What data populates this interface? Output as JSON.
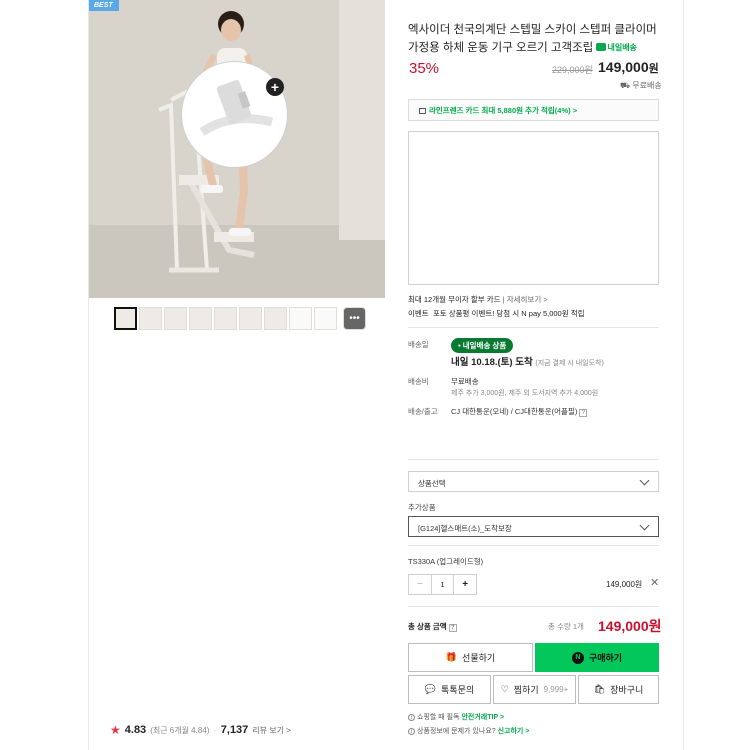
{
  "product": {
    "badge": "BEST",
    "title": "엑사이더 천국의계단 스텝밀 스카이 스텝퍼 클라이머 가정용 하체 운동 기구 오르기 고객조립",
    "delivery_tag": "내일배송",
    "discount": "35%",
    "original_price": "229,000원",
    "price": "149,000",
    "price_unit": "원",
    "shipping": "무료배송"
  },
  "card_banner": "라인프렌즈 카드 최대 5,880원 추가 적립(4%) >",
  "benefits": {
    "installment": "최대 12개월 무이자 할부 카드",
    "details_link": "자세히보기 >",
    "event_label": "이벤트",
    "event_text": "포토 상품평 이벤트! 당첨 시 N pay 5,000원 적립"
  },
  "delivery": {
    "label": "배송일",
    "pill": "내일배송 상품",
    "arrival": "내일 10.18.(토) 도착",
    "arrival_note": "(지금 결제 시 내일도착)",
    "fee_label": "배송비",
    "fee": "무료배송",
    "fee_note": "제주 추가 3,000원, 제주 외 도서지역 추가 4,000원",
    "courier_label": "배송/출고",
    "courier": "CJ 대한통운(오네) / CJ대한통운(어플필)"
  },
  "options": {
    "select_placeholder": "상품선택",
    "addon_label": "추가상품",
    "addon_value": "[G124]헬스매트(소)_도착보장",
    "selected_name": "TS330A (업그레이드형)",
    "qty": "1",
    "minus": "−",
    "plus": "+",
    "line_price": "149,000원",
    "remove": "✕"
  },
  "total": {
    "label": "총 상품 금액",
    "qty": "총 수량 1개",
    "price": "149,000원"
  },
  "buttons": {
    "gift": "선물하기",
    "buy": "구매하기",
    "talk": "톡톡문의",
    "wish": "찜하기",
    "wish_count": "9,999+",
    "cart": "장바구니"
  },
  "footer": {
    "line1_prefix": "쇼핑할 때 필독",
    "line1_link": "안전거래TIP >",
    "line2_prefix": "상품정보에 문제가 있나요?",
    "line2_link": "신고하기 >"
  },
  "rating": {
    "score": "4.83",
    "recent": "(최근 6개월 4.84)",
    "count": "7,137",
    "review_label": "리뷰 보기 >"
  },
  "colors": {
    "accent_green": "#03c75a",
    "price_red": "#c8102e",
    "badge_blue": "#5aa9e6"
  }
}
